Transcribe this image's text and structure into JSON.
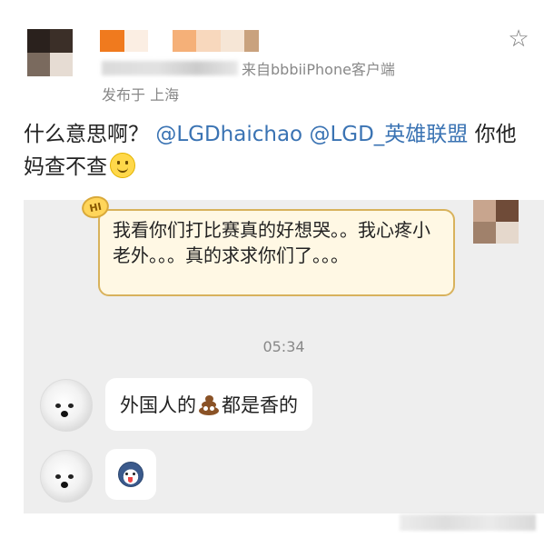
{
  "post": {
    "meta": {
      "source": "来自bbbiiPhone客户端",
      "location": "发布于 上海"
    },
    "text": {
      "prefix": "什么意思啊？",
      "mention1": "@LGDhaichao",
      "mention2": "@LGD_英雄联盟",
      "suffix": "你他妈查不查"
    }
  },
  "chat": {
    "outgoing_message": "我看你们打比赛真的好想哭。。我心疼小老外。。。真的求求你们了。。。",
    "hi_badge": "HI",
    "time": "05:34",
    "incoming_1": {
      "before": "外国人的",
      "after": "都是香的"
    }
  },
  "icons": {
    "star": "star-outline-icon",
    "smile": "smile-emoji-icon",
    "poop": "poop-emoji-icon",
    "husky": "husky-sticker-icon"
  },
  "colors": {
    "mention": "#3a73b3",
    "chat_background": "#eeeeee",
    "bubble_border": "#d8b25c",
    "bubble_fill": "#fff8e4"
  }
}
